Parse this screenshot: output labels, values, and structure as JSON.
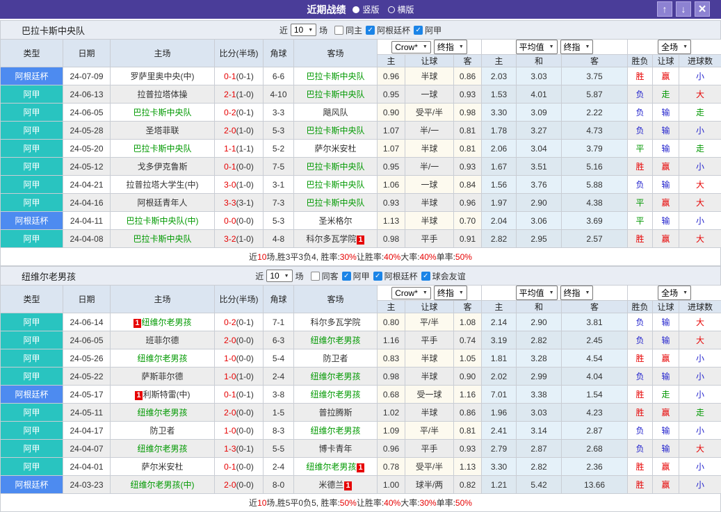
{
  "title_bar": {
    "title": "近期战绩",
    "layout_options": [
      {
        "label": "竖版",
        "selected": true
      },
      {
        "label": "横版",
        "selected": false
      }
    ],
    "buttons": {
      "up": "↑",
      "down": "↓",
      "close": "×"
    }
  },
  "colors": {
    "titlebar_purple": "#4a3d99",
    "cup_badge_blue": "#4d8bf0",
    "league_badge_teal": "#29c4c0",
    "focus_team_green": "#009900",
    "win_red": "#e60000",
    "draw_green": "#009700",
    "lose_blue": "#2323cd",
    "checkbox_blue": "#1b84e7"
  },
  "columns": {
    "type": "类型",
    "date": "日期",
    "home": "主场",
    "score": "比分(半场)",
    "corner": "角球",
    "away": "客场",
    "odds_home": "主",
    "odds_handicap": "让球",
    "odds_away": "客",
    "avg_home": "主",
    "avg_draw": "和",
    "avg_away": "客",
    "wdl": "胜负",
    "handicap_result": "让球",
    "goals": "进球数"
  },
  "sections": [
    {
      "team": "巴拉卡斯中央队",
      "filter": {
        "near": "近",
        "count": "10",
        "games": "场",
        "checks": [
          {
            "label": "同主",
            "checked": false
          },
          {
            "label": "阿根廷杯",
            "checked": true
          },
          {
            "label": "阿甲",
            "checked": true
          }
        ]
      },
      "selects": {
        "odds_source": "Crow*",
        "odds_kind": "终指",
        "avg_source": "平均值",
        "avg_kind": "终指",
        "scope": "全场"
      },
      "rows": [
        {
          "league": "阿根廷杯",
          "league_type": "cup",
          "date": "24-07-09",
          "home": "罗萨里奥中央(中)",
          "home_focus": false,
          "home_badge": "",
          "score_ft": "0-1",
          "score_ht": "(0-1)",
          "corner": "6-6",
          "away": "巴拉卡斯中央队",
          "away_focus": true,
          "away_badge": "",
          "crow": [
            "0.96",
            "半球",
            "0.86"
          ],
          "avg": [
            "2.03",
            "3.03",
            "3.75"
          ],
          "results": [
            [
              "胜",
              "r"
            ],
            [
              "赢",
              "r"
            ],
            [
              "小",
              "b"
            ]
          ]
        },
        {
          "league": "阿甲",
          "league_type": "league",
          "date": "24-06-13",
          "home": "拉普拉塔体操",
          "home_focus": false,
          "home_badge": "",
          "score_ft": "2-1",
          "score_ht": "(1-0)",
          "corner": "4-10",
          "away": "巴拉卡斯中央队",
          "away_focus": true,
          "away_badge": "",
          "crow": [
            "0.95",
            "一球",
            "0.93"
          ],
          "avg": [
            "1.53",
            "4.01",
            "5.87"
          ],
          "results": [
            [
              "负",
              "b"
            ],
            [
              "走",
              "g"
            ],
            [
              "大",
              "r"
            ]
          ]
        },
        {
          "league": "阿甲",
          "league_type": "league",
          "date": "24-06-05",
          "home": "巴拉卡斯中央队",
          "home_focus": true,
          "home_badge": "",
          "score_ft": "0-2",
          "score_ht": "(0-1)",
          "corner": "3-3",
          "away": "飓风队",
          "away_focus": false,
          "away_badge": "",
          "crow": [
            "0.90",
            "受平/半",
            "0.98"
          ],
          "avg": [
            "3.30",
            "3.09",
            "2.22"
          ],
          "results": [
            [
              "负",
              "b"
            ],
            [
              "输",
              "b"
            ],
            [
              "走",
              "g"
            ]
          ]
        },
        {
          "league": "阿甲",
          "league_type": "league",
          "date": "24-05-28",
          "home": "圣塔菲联",
          "home_focus": false,
          "home_badge": "",
          "score_ft": "2-0",
          "score_ht": "(1-0)",
          "corner": "5-3",
          "away": "巴拉卡斯中央队",
          "away_focus": true,
          "away_badge": "",
          "crow": [
            "1.07",
            "半/一",
            "0.81"
          ],
          "avg": [
            "1.78",
            "3.27",
            "4.73"
          ],
          "results": [
            [
              "负",
              "b"
            ],
            [
              "输",
              "b"
            ],
            [
              "小",
              "b"
            ]
          ]
        },
        {
          "league": "阿甲",
          "league_type": "league",
          "date": "24-05-20",
          "home": "巴拉卡斯中央队",
          "home_focus": true,
          "home_badge": "",
          "score_ft": "1-1",
          "score_ht": "(1-1)",
          "corner": "5-2",
          "away": "萨尔米安杜",
          "away_focus": false,
          "away_badge": "",
          "crow": [
            "1.07",
            "半球",
            "0.81"
          ],
          "avg": [
            "2.06",
            "3.04",
            "3.79"
          ],
          "results": [
            [
              "平",
              "g"
            ],
            [
              "输",
              "b"
            ],
            [
              "走",
              "g"
            ]
          ]
        },
        {
          "league": "阿甲",
          "league_type": "league",
          "date": "24-05-12",
          "home": "戈多伊克鲁斯",
          "home_focus": false,
          "home_badge": "",
          "score_ft": "0-1",
          "score_ht": "(0-0)",
          "corner": "7-5",
          "away": "巴拉卡斯中央队",
          "away_focus": true,
          "away_badge": "",
          "crow": [
            "0.95",
            "半/一",
            "0.93"
          ],
          "avg": [
            "1.67",
            "3.51",
            "5.16"
          ],
          "results": [
            [
              "胜",
              "r"
            ],
            [
              "赢",
              "r"
            ],
            [
              "小",
              "b"
            ]
          ]
        },
        {
          "league": "阿甲",
          "league_type": "league",
          "date": "24-04-21",
          "home": "拉普拉塔大学生(中)",
          "home_focus": false,
          "home_badge": "",
          "score_ft": "3-0",
          "score_ht": "(1-0)",
          "corner": "3-1",
          "away": "巴拉卡斯中央队",
          "away_focus": true,
          "away_badge": "",
          "crow": [
            "1.06",
            "一球",
            "0.84"
          ],
          "avg": [
            "1.56",
            "3.76",
            "5.88"
          ],
          "results": [
            [
              "负",
              "b"
            ],
            [
              "输",
              "b"
            ],
            [
              "大",
              "r"
            ]
          ]
        },
        {
          "league": "阿甲",
          "league_type": "league",
          "date": "24-04-16",
          "home": "阿根廷青年人",
          "home_focus": false,
          "home_badge": "",
          "score_ft": "3-3",
          "score_ht": "(3-1)",
          "corner": "7-3",
          "away": "巴拉卡斯中央队",
          "away_focus": true,
          "away_badge": "",
          "crow": [
            "0.93",
            "半球",
            "0.96"
          ],
          "avg": [
            "1.97",
            "2.90",
            "4.38"
          ],
          "results": [
            [
              "平",
              "g"
            ],
            [
              "赢",
              "r"
            ],
            [
              "大",
              "r"
            ]
          ]
        },
        {
          "league": "阿根廷杯",
          "league_type": "cup",
          "date": "24-04-11",
          "home": "巴拉卡斯中央队(中)",
          "home_focus": true,
          "home_badge": "",
          "score_ft": "0-0",
          "score_ht": "(0-0)",
          "corner": "5-3",
          "away": "圣米格尔",
          "away_focus": false,
          "away_badge": "",
          "crow": [
            "1.13",
            "半球",
            "0.70"
          ],
          "avg": [
            "2.04",
            "3.06",
            "3.69"
          ],
          "results": [
            [
              "平",
              "g"
            ],
            [
              "输",
              "b"
            ],
            [
              "小",
              "b"
            ]
          ]
        },
        {
          "league": "阿甲",
          "league_type": "league",
          "date": "24-04-08",
          "home": "巴拉卡斯中央队",
          "home_focus": true,
          "home_badge": "",
          "score_ft": "3-2",
          "score_ht": "(1-0)",
          "corner": "4-8",
          "away": "科尔多瓦学院",
          "away_focus": false,
          "away_badge": "1",
          "crow": [
            "0.98",
            "平手",
            "0.91"
          ],
          "avg": [
            "2.82",
            "2.95",
            "2.57"
          ],
          "results": [
            [
              "胜",
              "r"
            ],
            [
              "赢",
              "r"
            ],
            [
              "大",
              "r"
            ]
          ]
        }
      ],
      "summary": [
        [
          "近",
          "k"
        ],
        [
          "10",
          "r"
        ],
        [
          "场,胜3平3负4, 胜率:",
          "k"
        ],
        [
          "30%",
          "r"
        ],
        [
          " 让胜率:",
          "k"
        ],
        [
          "40%",
          "r"
        ],
        [
          " 大率:",
          "k"
        ],
        [
          "40%",
          "r"
        ],
        [
          " 单率:",
          "k"
        ],
        [
          "50%",
          "r"
        ]
      ]
    },
    {
      "team": "纽维尔老男孩",
      "filter": {
        "near": "近",
        "count": "10",
        "games": "场",
        "checks": [
          {
            "label": "同客",
            "checked": false
          },
          {
            "label": "阿甲",
            "checked": true
          },
          {
            "label": "阿根廷杯",
            "checked": true
          },
          {
            "label": "球会友谊",
            "checked": true
          }
        ]
      },
      "selects": {
        "odds_source": "Crow*",
        "odds_kind": "终指",
        "avg_source": "平均值",
        "avg_kind": "终指",
        "scope": "全场"
      },
      "rows": [
        {
          "league": "阿甲",
          "league_type": "league",
          "date": "24-06-14",
          "home": "纽维尔老男孩",
          "home_focus": true,
          "home_badge": "1",
          "score_ft": "0-2",
          "score_ht": "(0-1)",
          "corner": "7-1",
          "away": "科尔多瓦学院",
          "away_focus": false,
          "away_badge": "",
          "crow": [
            "0.80",
            "平/半",
            "1.08"
          ],
          "avg": [
            "2.14",
            "2.90",
            "3.81"
          ],
          "results": [
            [
              "负",
              "b"
            ],
            [
              "输",
              "b"
            ],
            [
              "大",
              "r"
            ]
          ]
        },
        {
          "league": "阿甲",
          "league_type": "league",
          "date": "24-06-05",
          "home": "班菲尔德",
          "home_focus": false,
          "home_badge": "",
          "score_ft": "2-0",
          "score_ht": "(0-0)",
          "corner": "6-3",
          "away": "纽维尔老男孩",
          "away_focus": true,
          "away_badge": "",
          "crow": [
            "1.16",
            "平手",
            "0.74"
          ],
          "avg": [
            "3.19",
            "2.82",
            "2.45"
          ],
          "results": [
            [
              "负",
              "b"
            ],
            [
              "输",
              "b"
            ],
            [
              "大",
              "r"
            ]
          ]
        },
        {
          "league": "阿甲",
          "league_type": "league",
          "date": "24-05-26",
          "home": "纽维尔老男孩",
          "home_focus": true,
          "home_badge": "",
          "score_ft": "1-0",
          "score_ht": "(0-0)",
          "corner": "5-4",
          "away": "防卫者",
          "away_focus": false,
          "away_badge": "",
          "crow": [
            "0.83",
            "半球",
            "1.05"
          ],
          "avg": [
            "1.81",
            "3.28",
            "4.54"
          ],
          "results": [
            [
              "胜",
              "r"
            ],
            [
              "赢",
              "r"
            ],
            [
              "小",
              "b"
            ]
          ]
        },
        {
          "league": "阿甲",
          "league_type": "league",
          "date": "24-05-22",
          "home": "萨斯菲尔德",
          "home_focus": false,
          "home_badge": "",
          "score_ft": "1-0",
          "score_ht": "(1-0)",
          "corner": "2-4",
          "away": "纽维尔老男孩",
          "away_focus": true,
          "away_badge": "",
          "crow": [
            "0.98",
            "半球",
            "0.90"
          ],
          "avg": [
            "2.02",
            "2.99",
            "4.04"
          ],
          "results": [
            [
              "负",
              "b"
            ],
            [
              "输",
              "b"
            ],
            [
              "小",
              "b"
            ]
          ]
        },
        {
          "league": "阿根廷杯",
          "league_type": "cup",
          "date": "24-05-17",
          "home": "利斯特雷(中)",
          "home_focus": false,
          "home_badge": "1",
          "score_ft": "0-1",
          "score_ht": "(0-1)",
          "corner": "3-8",
          "away": "纽维尔老男孩",
          "away_focus": true,
          "away_badge": "",
          "crow": [
            "0.68",
            "受一球",
            "1.16"
          ],
          "avg": [
            "7.01",
            "3.38",
            "1.54"
          ],
          "results": [
            [
              "胜",
              "r"
            ],
            [
              "走",
              "g"
            ],
            [
              "小",
              "b"
            ]
          ]
        },
        {
          "league": "阿甲",
          "league_type": "league",
          "date": "24-05-11",
          "home": "纽维尔老男孩",
          "home_focus": true,
          "home_badge": "",
          "score_ft": "2-0",
          "score_ht": "(0-0)",
          "corner": "1-5",
          "away": "普拉腾斯",
          "away_focus": false,
          "away_badge": "",
          "crow": [
            "1.02",
            "半球",
            "0.86"
          ],
          "avg": [
            "1.96",
            "3.03",
            "4.23"
          ],
          "results": [
            [
              "胜",
              "r"
            ],
            [
              "赢",
              "r"
            ],
            [
              "走",
              "g"
            ]
          ]
        },
        {
          "league": "阿甲",
          "league_type": "league",
          "date": "24-04-17",
          "home": "防卫者",
          "home_focus": false,
          "home_badge": "",
          "score_ft": "1-0",
          "score_ht": "(0-0)",
          "corner": "8-3",
          "away": "纽维尔老男孩",
          "away_focus": true,
          "away_badge": "",
          "crow": [
            "1.09",
            "平/半",
            "0.81"
          ],
          "avg": [
            "2.41",
            "3.14",
            "2.87"
          ],
          "results": [
            [
              "负",
              "b"
            ],
            [
              "输",
              "b"
            ],
            [
              "小",
              "b"
            ]
          ]
        },
        {
          "league": "阿甲",
          "league_type": "league",
          "date": "24-04-07",
          "home": "纽维尔老男孩",
          "home_focus": true,
          "home_badge": "",
          "score_ft": "1-3",
          "score_ht": "(0-1)",
          "corner": "5-5",
          "away": "博卡青年",
          "away_focus": false,
          "away_badge": "",
          "crow": [
            "0.96",
            "平手",
            "0.93"
          ],
          "avg": [
            "2.79",
            "2.87",
            "2.68"
          ],
          "results": [
            [
              "负",
              "b"
            ],
            [
              "输",
              "b"
            ],
            [
              "大",
              "r"
            ]
          ]
        },
        {
          "league": "阿甲",
          "league_type": "league",
          "date": "24-04-01",
          "home": "萨尔米安杜",
          "home_focus": false,
          "home_badge": "",
          "score_ft": "0-1",
          "score_ht": "(0-0)",
          "corner": "2-4",
          "away": "纽维尔老男孩",
          "away_focus": true,
          "away_badge": "1",
          "crow": [
            "0.78",
            "受平/半",
            "1.13"
          ],
          "avg": [
            "3.30",
            "2.82",
            "2.36"
          ],
          "results": [
            [
              "胜",
              "r"
            ],
            [
              "赢",
              "r"
            ],
            [
              "小",
              "b"
            ]
          ]
        },
        {
          "league": "阿根廷杯",
          "league_type": "cup",
          "date": "24-03-23",
          "home": "纽维尔老男孩(中)",
          "home_focus": true,
          "home_badge": "",
          "score_ft": "2-0",
          "score_ht": "(0-0)",
          "corner": "8-0",
          "away": "米德兰",
          "away_focus": false,
          "away_badge": "1",
          "crow": [
            "1.00",
            "球半/两",
            "0.82"
          ],
          "avg": [
            "1.21",
            "5.42",
            "13.66"
          ],
          "results": [
            [
              "胜",
              "r"
            ],
            [
              "赢",
              "r"
            ],
            [
              "小",
              "b"
            ]
          ]
        }
      ],
      "summary": [
        [
          "近",
          "k"
        ],
        [
          "10",
          "r"
        ],
        [
          "场,胜5平0负5, 胜率:",
          "k"
        ],
        [
          "50%",
          "r"
        ],
        [
          " 让胜率:",
          "k"
        ],
        [
          "40%",
          "r"
        ],
        [
          " 大率:",
          "k"
        ],
        [
          "30%",
          "r"
        ],
        [
          " 单率:",
          "k"
        ],
        [
          "50%",
          "r"
        ]
      ]
    }
  ]
}
